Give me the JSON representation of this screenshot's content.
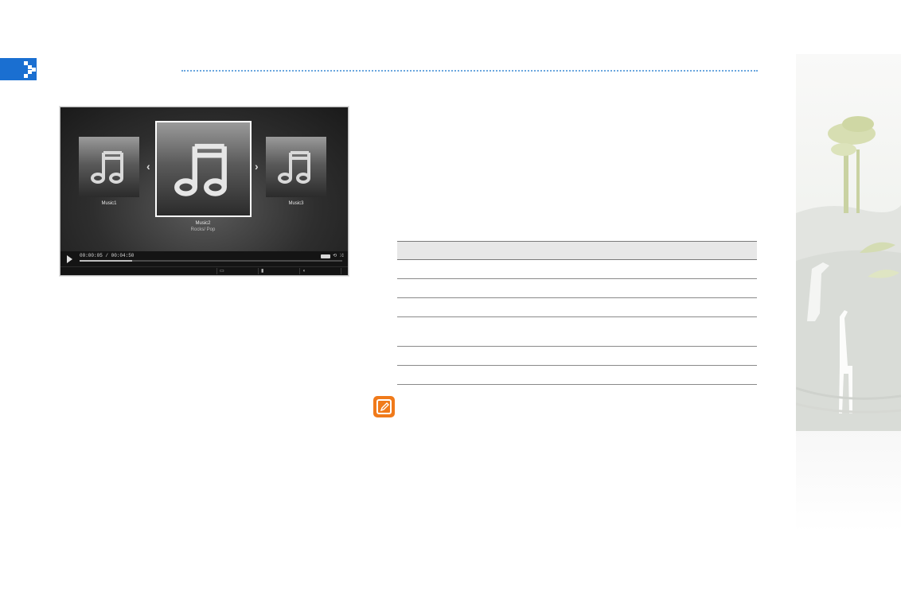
{
  "player": {
    "tiles": [
      {
        "label": "Music1"
      },
      {
        "label": "Music2",
        "sublabel": "Rocks/ Pop"
      },
      {
        "label": "Music3"
      }
    ],
    "time": "00:00:05 / 00:04:50",
    "progress": 0.2
  },
  "colors": {
    "header_accent": "#1a6fd1",
    "note_icon": "#f07a1a"
  },
  "icons": {
    "header_marker": "pixel-arrow-icon",
    "note": "pencil-note-icon",
    "tile": "music-note-icon"
  }
}
